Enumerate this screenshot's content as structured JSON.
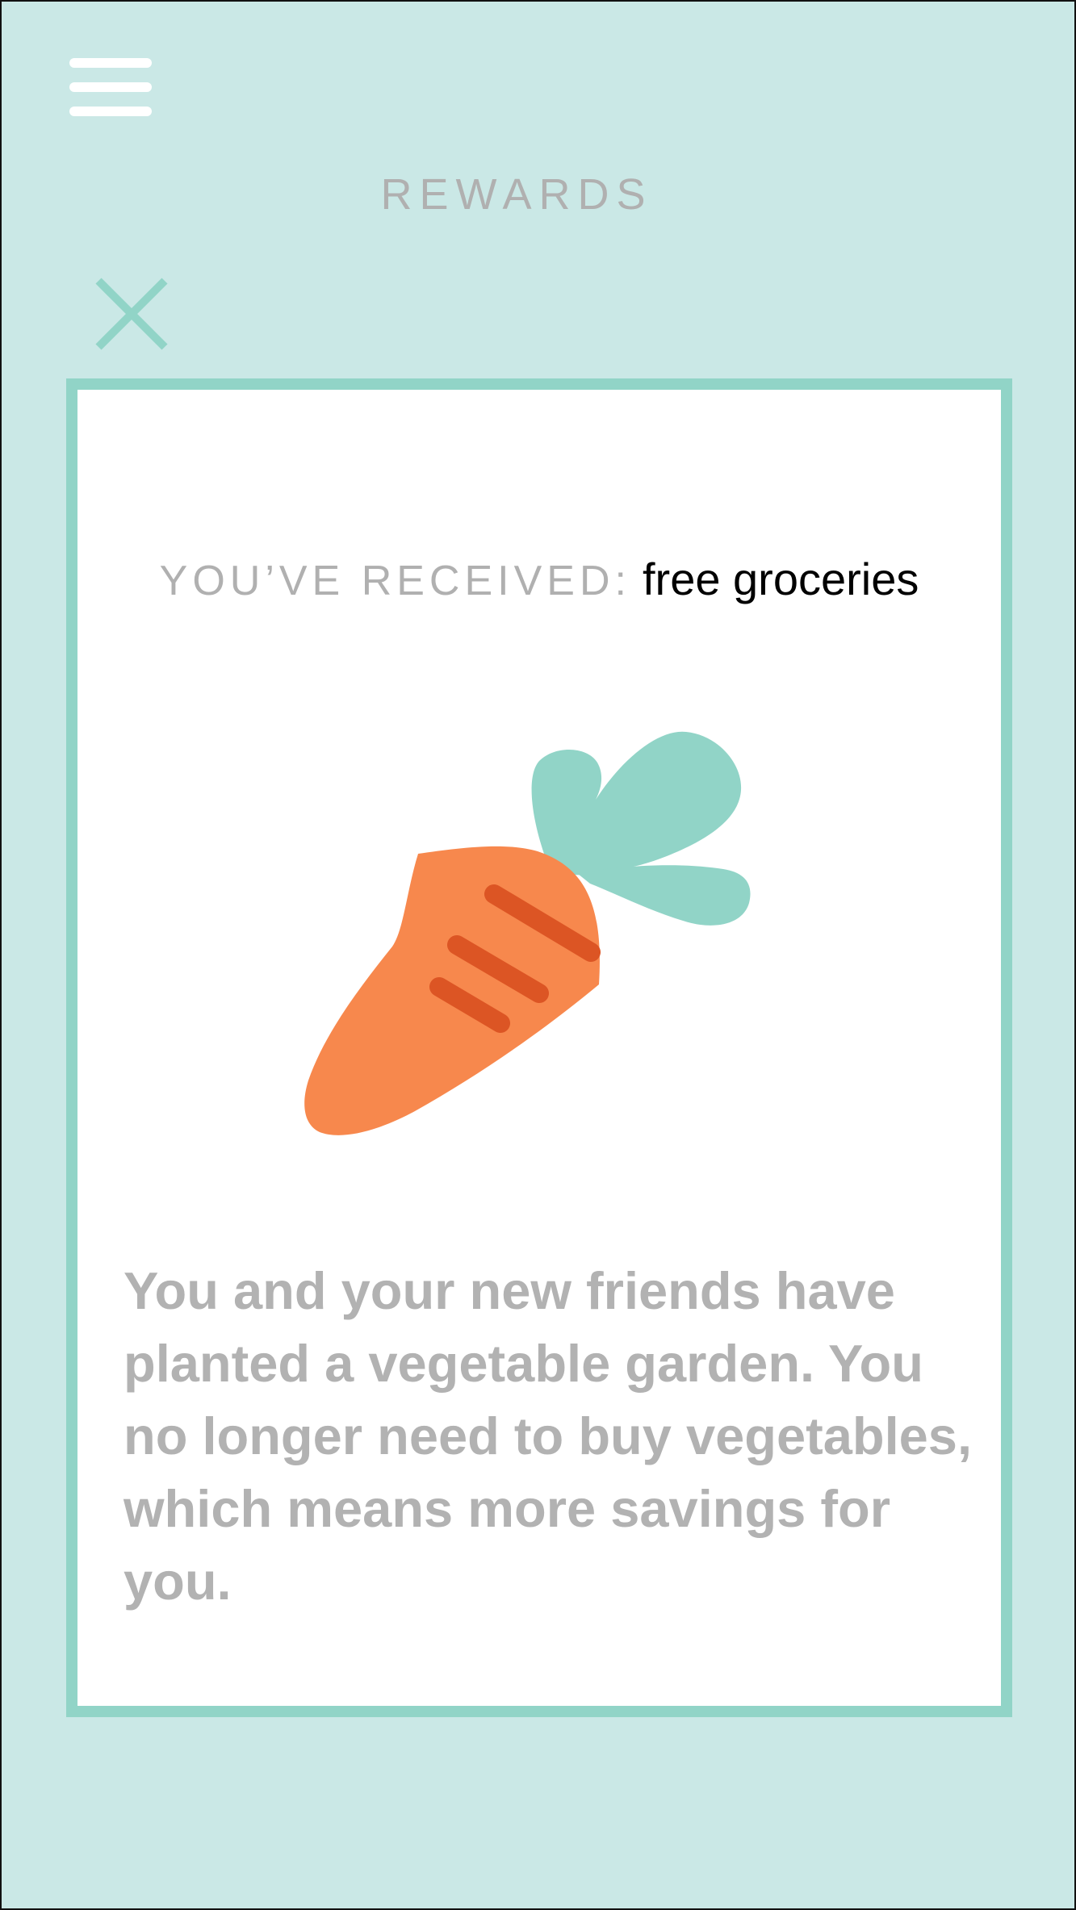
{
  "header": {
    "title": "REWARDS",
    "menu_icon": "hamburger-menu-icon",
    "close_icon": "close-icon"
  },
  "reward": {
    "label": "YOU’VE RECEIVED:",
    "value": "free groceries",
    "illustration_icon": "carrot-icon",
    "message": "You and your new friends have planted a vegetable garden. You no longer need to buy vegetables, which means more savings for you."
  },
  "colors": {
    "background": "#cae8e6",
    "accent": "#91d4c7",
    "carrot": "#f7884d",
    "carrot_stripes": "#dc5524",
    "muted_text": "#b0b0b0"
  }
}
